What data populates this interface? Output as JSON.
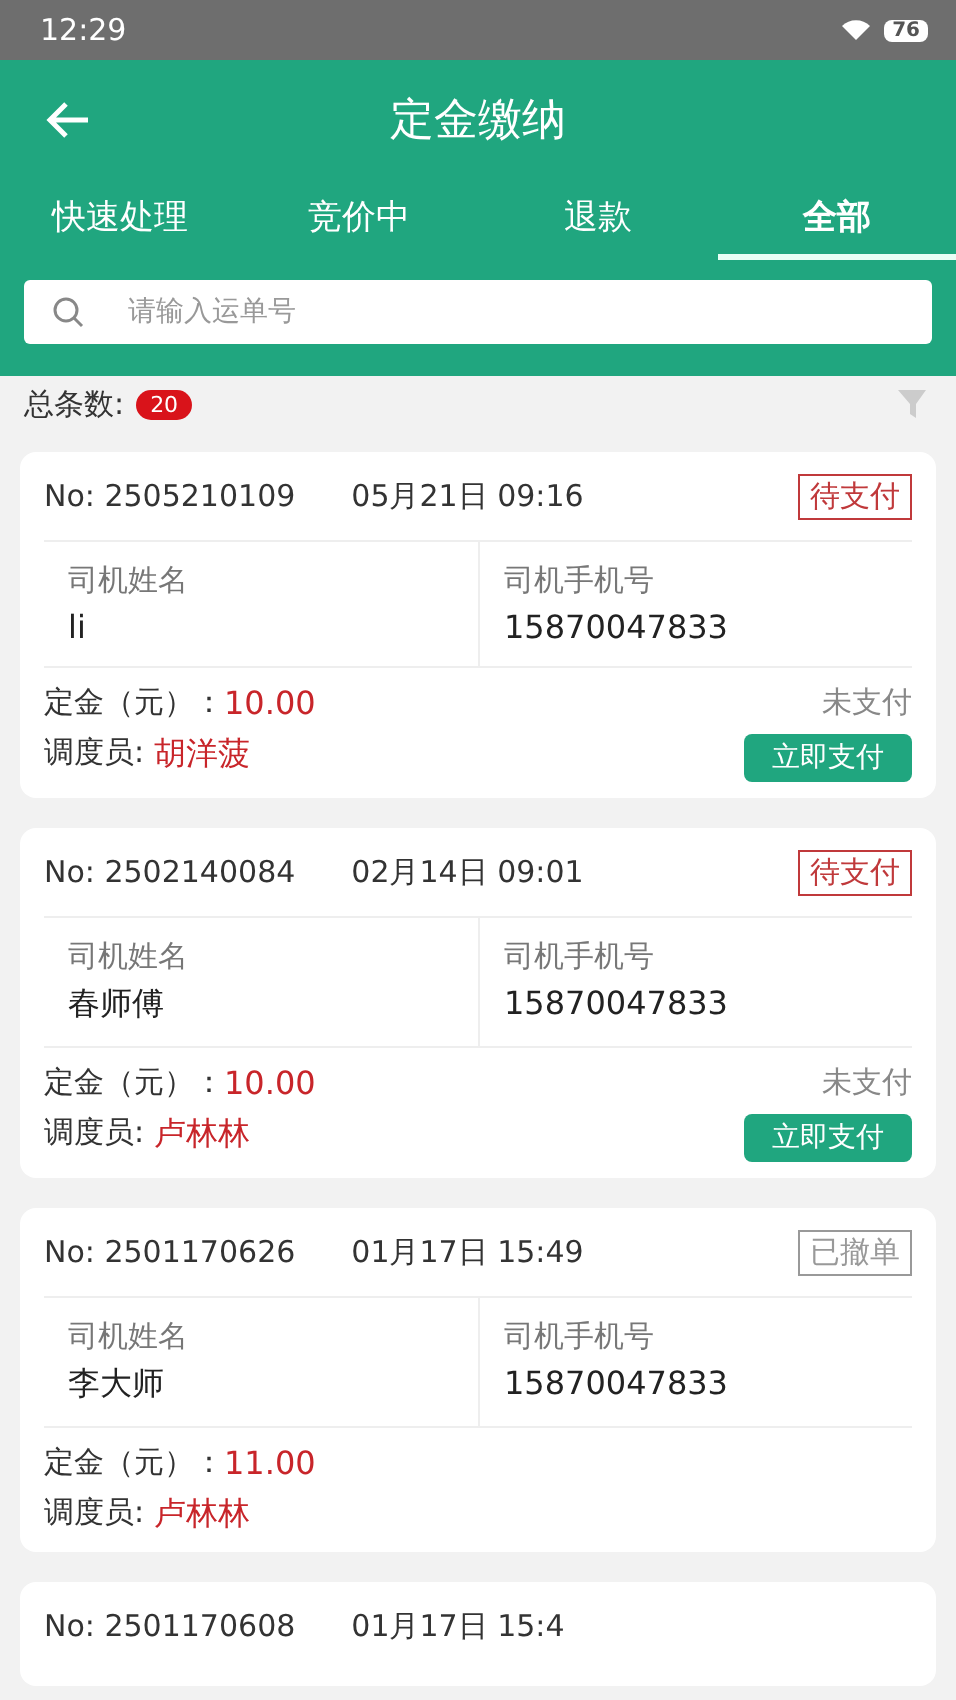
{
  "status_bar": {
    "time": "12:29",
    "battery": "76"
  },
  "header": {
    "title": "定金缴纳"
  },
  "tabs": [
    {
      "label": "快速处理",
      "selected": false
    },
    {
      "label": "竞价中",
      "selected": false
    },
    {
      "label": "退款",
      "selected": false
    },
    {
      "label": "全部",
      "selected": true
    }
  ],
  "search": {
    "placeholder": "请输入运单号"
  },
  "summary": {
    "label": "总条数:",
    "count": "20"
  },
  "orders": [
    {
      "no": "No: 2505210109",
      "datetime": "05月21日 09:16",
      "status": {
        "text": "待支付",
        "kind": "pending"
      },
      "driver_name_label": "司机姓名",
      "driver_name": "li",
      "driver_phone_label": "司机手机号",
      "driver_phone": "15870047833",
      "deposit_label": "定金（元）：",
      "deposit": "10.00",
      "dispatcher_label": "调度员:",
      "dispatcher": "胡洋菠",
      "payment_status": "未支付",
      "pay_button": "立即支付"
    },
    {
      "no": "No: 2502140084",
      "datetime": "02月14日 09:01",
      "status": {
        "text": "待支付",
        "kind": "pending"
      },
      "driver_name_label": "司机姓名",
      "driver_name": "春师傅",
      "driver_phone_label": "司机手机号",
      "driver_phone": "15870047833",
      "deposit_label": "定金（元）：",
      "deposit": "10.00",
      "dispatcher_label": "调度员:",
      "dispatcher": "卢林林",
      "payment_status": "未支付",
      "pay_button": "立即支付"
    },
    {
      "no": "No: 2501170626",
      "datetime": "01月17日 15:49",
      "status": {
        "text": "已撤单",
        "kind": "cancelled"
      },
      "driver_name_label": "司机姓名",
      "driver_name": "李大师",
      "driver_phone_label": "司机手机号",
      "driver_phone": "15870047833",
      "deposit_label": "定金（元）：",
      "deposit": "11.00",
      "dispatcher_label": "调度员:",
      "dispatcher": "卢林林"
    },
    {
      "no": "No: 2501170608",
      "datetime": "01月17日 15:4"
    }
  ]
}
